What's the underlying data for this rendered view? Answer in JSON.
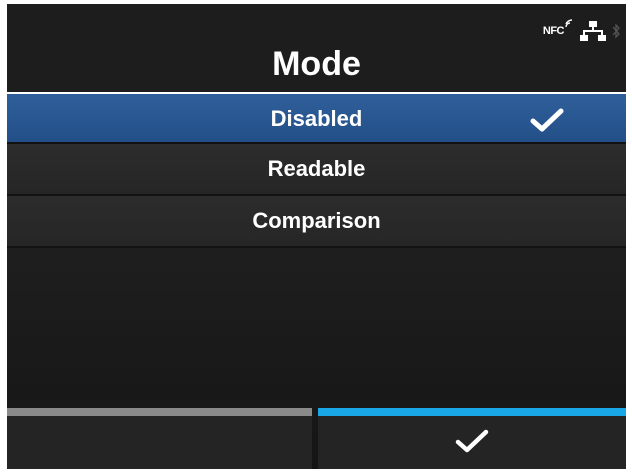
{
  "header": {
    "title": "Mode",
    "status_icons": [
      "nfc-icon",
      "network-icon",
      "bluetooth-icon"
    ],
    "nfc_label": "NFC"
  },
  "options": [
    {
      "label": "Disabled",
      "selected": true
    },
    {
      "label": "Readable",
      "selected": false
    },
    {
      "label": "Comparison",
      "selected": false
    }
  ],
  "softkeys": {
    "left_icon": "",
    "right_icon": "checkmark-icon"
  },
  "colors": {
    "selected_row": "#234f88",
    "right_softkey_accent": "#1aa7e8",
    "left_softkey_accent": "#8a8a8a",
    "text": "#ffffff"
  }
}
